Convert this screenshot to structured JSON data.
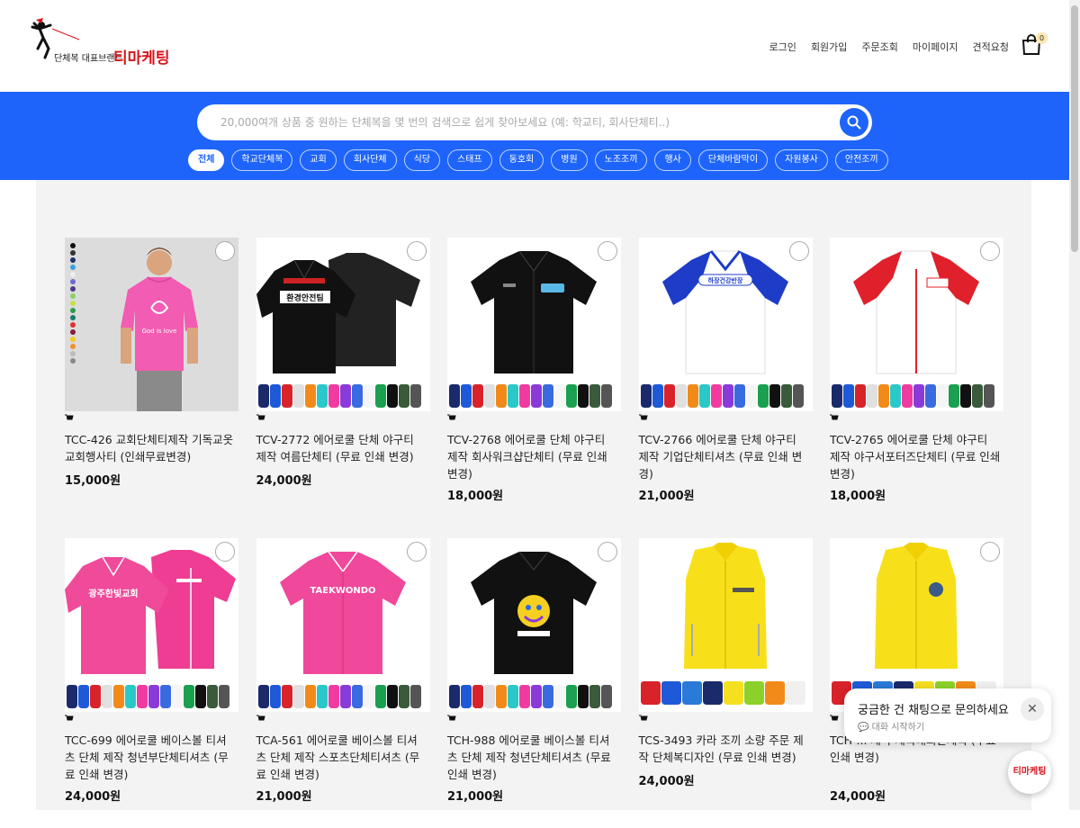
{
  "brand": {
    "tagline": "단체복 대표브랜드",
    "name": "티마케팅",
    "accent": "#d8131b"
  },
  "topnav": [
    "로그인",
    "회원가입",
    "주문조회",
    "마이페이지",
    "견적요청"
  ],
  "cart": {
    "count": "0"
  },
  "search": {
    "placeholder": "20,000여개 상품 중 원하는 단체복을 몇 번의 검색으로 쉽게 찾아보세요 (예: 학교티, 회사단체티..)"
  },
  "categories": [
    "전체",
    "학교단체복",
    "교회",
    "회사단체",
    "식당",
    "스태프",
    "동호회",
    "병원",
    "노조조끼",
    "행사",
    "단체바람막이",
    "자원봉사",
    "안전조끼"
  ],
  "colors": {
    "band": "#1e64fa",
    "content_bg": "#f3f3f3"
  },
  "products": [
    {
      "title": "TCC-426 교회단체티제작 기독교옷 교회행사티 (인쇄무료변경)",
      "price": "15,000원",
      "icon": "pink-tshirt"
    },
    {
      "title": "TCV-2772 에어로쿨 단체 야구티 제작 여름단체티 (무료 인쇄 변경)",
      "price": "24,000원",
      "icon": "black-baseball-jersey",
      "print": "환경안전팀"
    },
    {
      "title": "TCV-2768 에어로쿨 단체 야구티 제작 회사워크샵단체티 (무료 인쇄 변경)",
      "price": "18,000원",
      "icon": "black-baseball-jersey"
    },
    {
      "title": "TCV-2766 에어로쿨 단체 야구티 제작 기업단체티셔츠 (무료 인쇄 변경)",
      "price": "21,000원",
      "icon": "blue-white-baseball-jersey",
      "print": "하장건강반장"
    },
    {
      "title": "TCV-2765 에어로쿨 단체 야구티 제작 야구서포터즈단체티 (무료 인쇄 변경)",
      "price": "18,000원",
      "icon": "red-white-baseball-jersey"
    },
    {
      "title": "TCC-699 에어로쿨 베이스볼 티셔츠 단체 제작 청년부단체티셔츠 (무료 인쇄 변경)",
      "price": "24,000원",
      "icon": "pink-baseball-jersey",
      "print": "광주한빛교회"
    },
    {
      "title": "TCA-561 에어로쿨 베이스볼 티셔츠 단체 제작 스포츠단체티셔츠 (무료 인쇄 변경)",
      "price": "21,000원",
      "icon": "pink-baseball-jersey",
      "print": "TAEKWONDO"
    },
    {
      "title": "TCH-988 에어로쿨 베이스볼 티셔츠 단체 제작 청년단체티셔츠 (무료 인쇄 변경)",
      "price": "21,000원",
      "icon": "black-baseball-jersey"
    },
    {
      "title": "TCS-3493 카라 조끼 소량 주문 제작 단체복디자인 (무료 인쇄 변경)",
      "price": "24,000원",
      "icon": "yellow-vest"
    },
    {
      "title": "TCH-... 제작 체육대회단체복 (무료 인쇄 변경)",
      "price": "24,000원",
      "icon": "yellow-vest"
    }
  ],
  "chat": {
    "title": "궁금한 건 채팅으로 문의하세요",
    "subtitle": "대화 시작하기",
    "close": "✕",
    "fab_label": "티마케팅"
  }
}
